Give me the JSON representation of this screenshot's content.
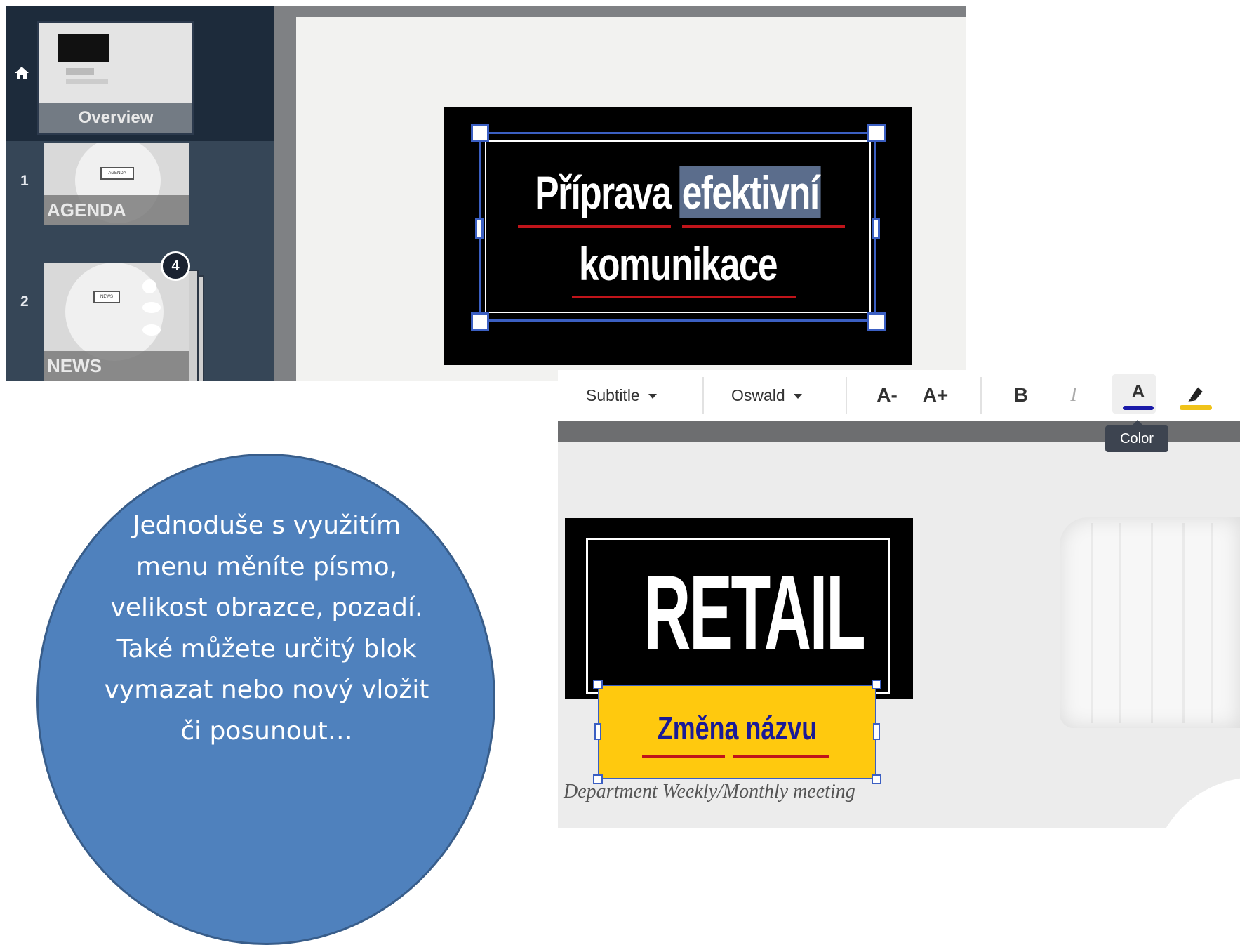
{
  "editor": {
    "overview_label": "Overview",
    "slides": [
      {
        "number": "1",
        "label": "AGENDA",
        "tag": "AGENDA"
      },
      {
        "number": "2",
        "label": "NEWS",
        "tag": "NEWS",
        "badge": "4"
      }
    ],
    "title": {
      "line1_part1": "Příprava",
      "line1_part2": "efektivní",
      "line2": "komunikace"
    }
  },
  "toolbar": {
    "style_select": "Subtitle",
    "font_select": "Oswald",
    "decrease_size": "A-",
    "increase_size": "A+",
    "bold": "B",
    "italic": "I",
    "color": "A",
    "color_tooltip": "Color",
    "colors": {
      "text_color": "#1a1aa8",
      "highlight": "#f0c31a"
    }
  },
  "slide": {
    "heading": "RETAIL",
    "subtitle": "Změna názvu",
    "subline": "Department Weekly/Monthly meeting"
  },
  "callout": {
    "text": "Jednoduše s využitím menu měníte písmo, velikost obrazce, pozadí. Také můžete určitý blok vymazat nebo nový vložit či posunout…"
  }
}
